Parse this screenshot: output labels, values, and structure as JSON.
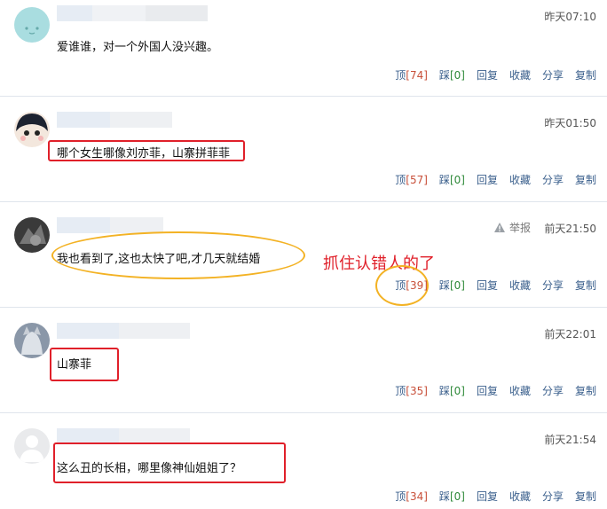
{
  "comments": [
    {
      "time": "昨天07:10",
      "text": "爱谁谁，对一个外国人没兴趣。",
      "actions": {
        "up": "顶",
        "up_count": "[74]",
        "down": "踩",
        "down_count": "[0]",
        "reply": "回复",
        "fav": "收藏",
        "share": "分享",
        "copy": "复制"
      }
    },
    {
      "time": "昨天01:50",
      "text": "哪个女生哪像刘亦菲，山寨拼菲菲",
      "actions": {
        "up": "顶",
        "up_count": "[57]",
        "down": "踩",
        "down_count": "[0]",
        "reply": "回复",
        "fav": "收藏",
        "share": "分享",
        "copy": "复制"
      }
    },
    {
      "time": "前天21:50",
      "report": "举报",
      "text": "我也看到了,这也太快了吧,才几天就结婚",
      "annotation": "抓住认错人的了",
      "actions": {
        "up": "顶",
        "up_count": "[39]",
        "down": "踩",
        "down_count": "[0]",
        "reply": "回复",
        "fav": "收藏",
        "share": "分享",
        "copy": "复制"
      }
    },
    {
      "time": "前天22:01",
      "text": "山寨菲",
      "actions": {
        "up": "顶",
        "up_count": "[35]",
        "down": "踩",
        "down_count": "[0]",
        "reply": "回复",
        "fav": "收藏",
        "share": "分享",
        "copy": "复制"
      }
    },
    {
      "time": "前天21:54",
      "text": "这么丑的长相，哪里像神仙姐姐了？",
      "actions": {
        "up": "顶",
        "up_count": "[34]",
        "down": "踩",
        "down_count": "[0]",
        "reply": "回复",
        "fav": "收藏",
        "share": "分享",
        "copy": "复制"
      }
    }
  ],
  "colors": {
    "link": "#3a5f8c",
    "up_count": "#c8503a",
    "down_count": "#2f8a3a",
    "highlight_box": "#e0202a",
    "highlight_oval": "#f3b224"
  }
}
